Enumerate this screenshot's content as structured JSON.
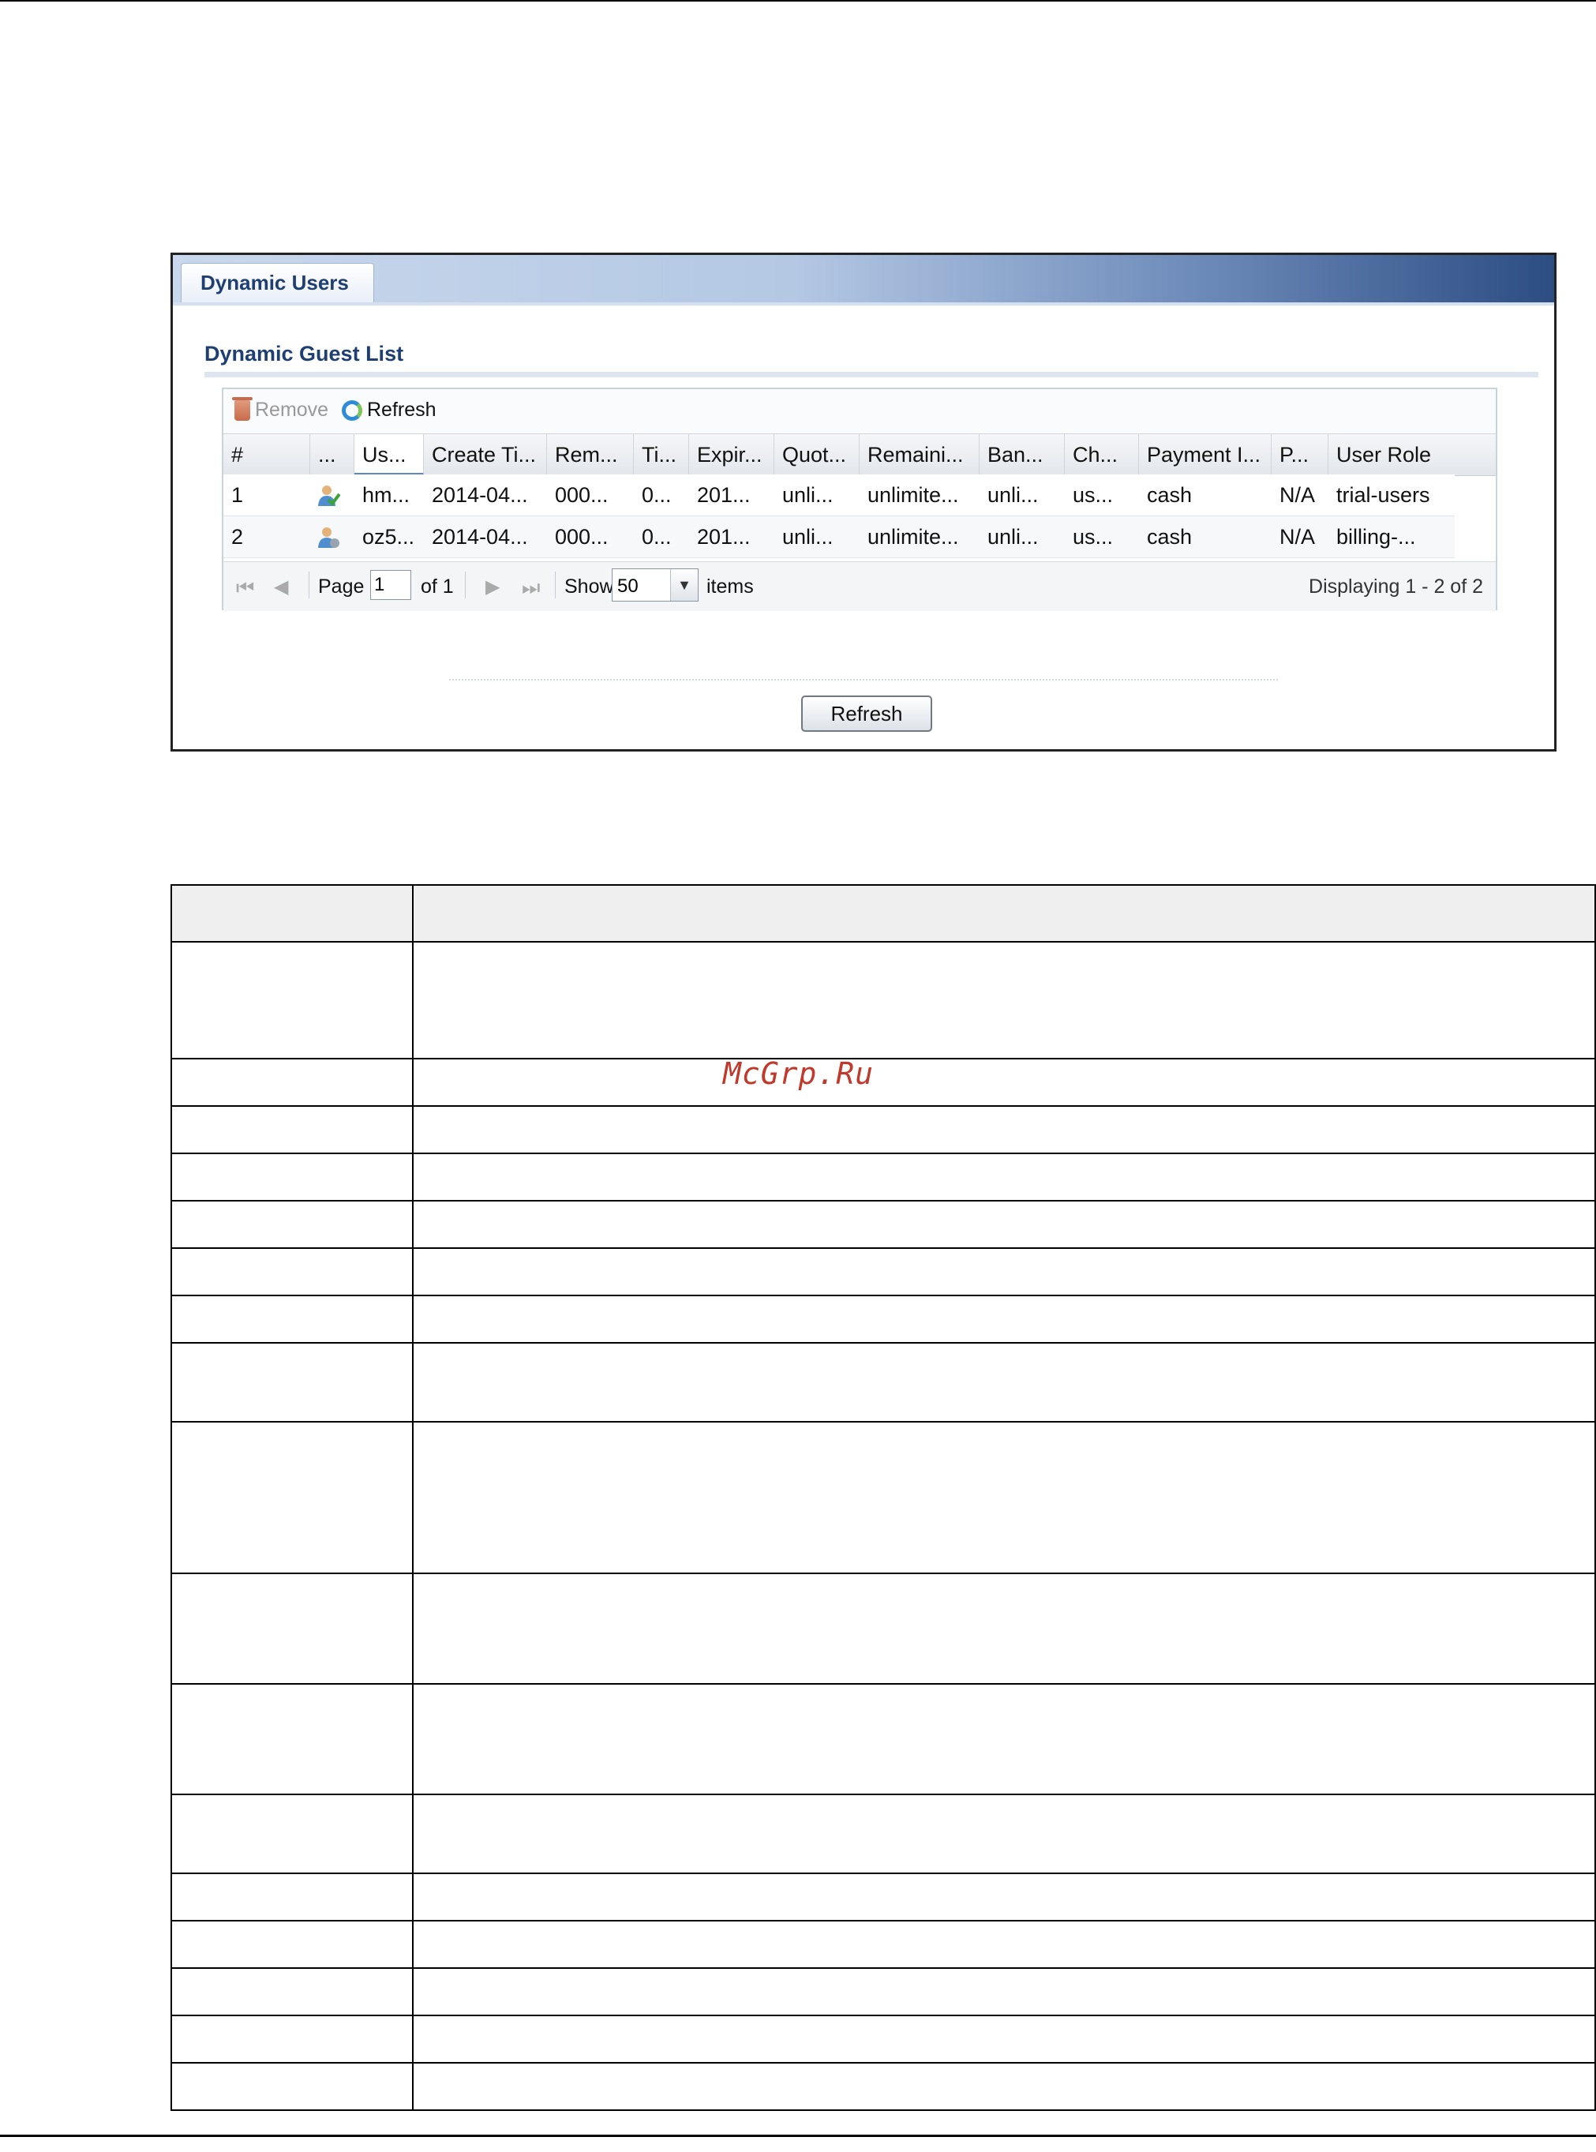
{
  "tab": {
    "label": "Dynamic Users"
  },
  "section_title": "Dynamic Guest List",
  "toolbar": {
    "remove_label": "Remove",
    "refresh_label": "Refresh"
  },
  "grid": {
    "columns": [
      "#",
      "...",
      "Us...",
      "Create Ti...",
      "Rem...",
      "Ti...",
      "Expir...",
      "Quot...",
      "Remaini...",
      "Ban...",
      "Ch...",
      "Payment I...",
      "P...",
      "User Role"
    ],
    "rows": [
      [
        "1",
        "",
        "hm...",
        "2014-04...",
        "000...",
        "0...",
        "201...",
        "unli...",
        "unlimite...",
        "unli...",
        "us...",
        "cash",
        "N/A",
        "trial-users"
      ],
      [
        "2",
        "",
        "oz5...",
        "2014-04...",
        "000...",
        "0...",
        "201...",
        "unli...",
        "unlimite...",
        "unli...",
        "us...",
        "cash",
        "N/A",
        "billing-..."
      ]
    ]
  },
  "pager": {
    "page_label": "Page",
    "page_value": "1",
    "of_label": "of 1",
    "show_label": "Show",
    "show_value": "50",
    "items_label": "items",
    "displaying": "Displaying 1 - 2 of 2"
  },
  "bottom_button": {
    "label": "Refresh"
  },
  "watermark": "McGrp.Ru",
  "colors": {
    "title_blue": "#1f3f73",
    "watermark_red": "#c0392b",
    "sort_underline": "#5b87c7"
  }
}
